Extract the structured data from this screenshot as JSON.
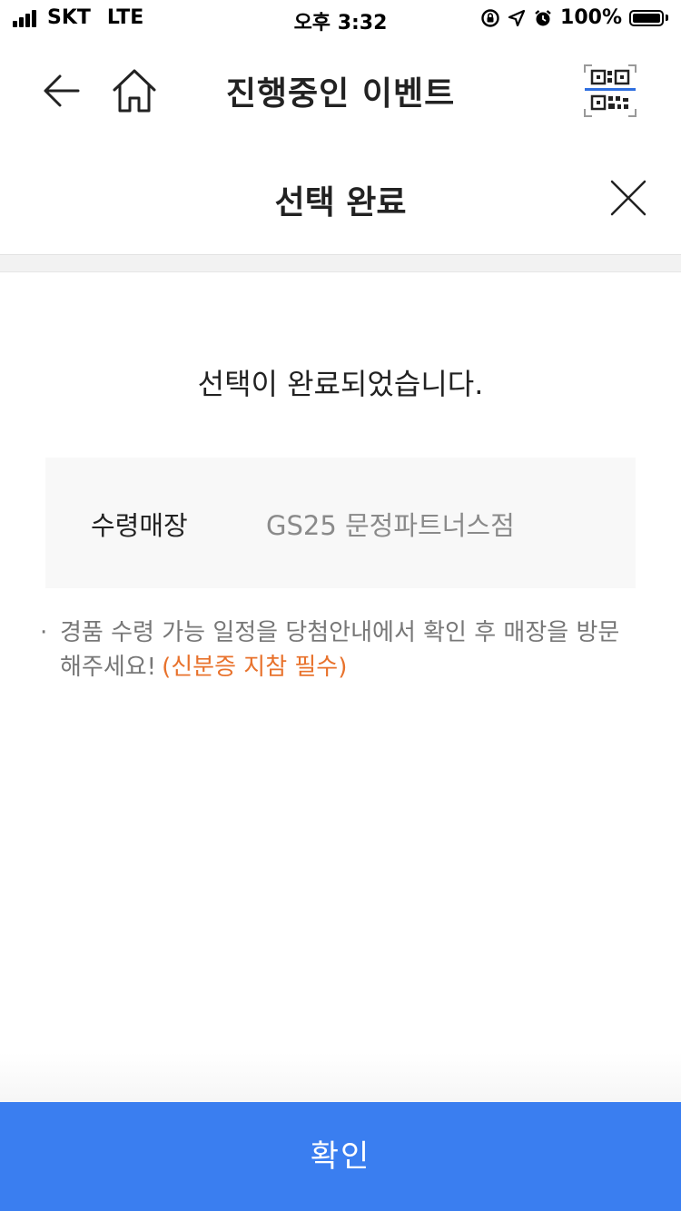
{
  "status_bar": {
    "carrier": "SKT",
    "network": "LTE",
    "time": "오후 3:32",
    "battery_text": "100%",
    "battery_level": 1.0
  },
  "nav": {
    "title": "진행중인 이벤트",
    "back_icon": "arrow-left-icon",
    "home_icon": "home-icon",
    "qr_icon": "qr-code-icon"
  },
  "modal": {
    "title": "선택 완료",
    "close_icon": "close-icon"
  },
  "message": "선택이 완료되었습니다.",
  "store": {
    "label": "수령매장",
    "value": "GS25 문정파트너스점"
  },
  "notice": {
    "bullet": "·",
    "text": "경품 수령 가능 일정을 당첨안내에서 확인 후 매장을 방문해주세요!",
    "highlight": "(신분증 지참 필수)"
  },
  "confirm_button": "확인",
  "colors": {
    "primary": "#3a7ef0",
    "highlight": "#e8722c",
    "qr_accent": "#2f6fe0"
  }
}
